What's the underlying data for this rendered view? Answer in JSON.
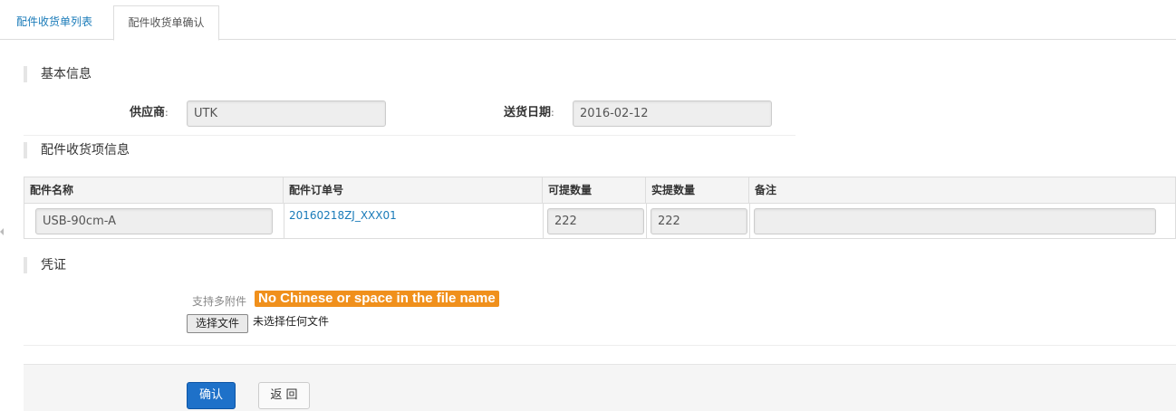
{
  "tabs": [
    {
      "label": "配件收货单列表"
    },
    {
      "label": "配件收货单确认"
    }
  ],
  "sections": {
    "basic_info": "基本信息",
    "items_info": "配件收货项信息",
    "voucher": "凭证"
  },
  "form": {
    "supplier_label": "供应商",
    "supplier_value": "UTK",
    "delivery_date_label": "送货日期",
    "delivery_date_value": "2016-02-12",
    "colon": ":"
  },
  "table": {
    "headers": [
      "配件名称",
      "配件订单号",
      "可提数量",
      "实提数量",
      "备注"
    ],
    "rows": [
      {
        "part_name": "USB-90cm-A",
        "order_no": "20160218ZJ_XXX01",
        "available_qty": "222",
        "actual_qty": "222",
        "remark": ""
      }
    ]
  },
  "attachment": {
    "hint": "支持多附件",
    "warning": "No Chinese or space in the file name",
    "choose_file_label": "选择文件",
    "no_file_label": "未选择任何文件"
  },
  "actions": {
    "confirm_label": "确认",
    "back_label": "返 回"
  },
  "colors": {
    "accent_link": "#1a7bb9",
    "primary_button": "#1e71c9",
    "warning_label": "#f0901c"
  }
}
